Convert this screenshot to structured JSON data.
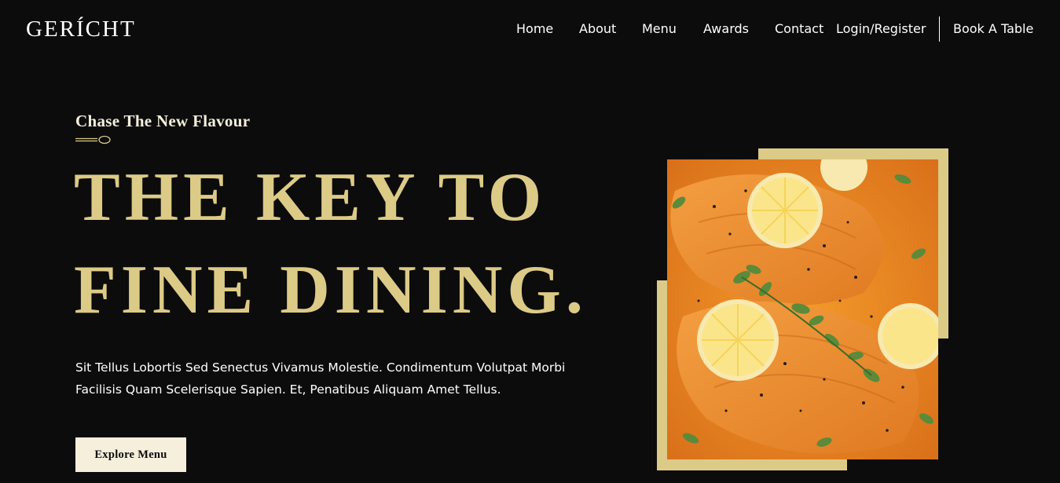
{
  "navbar": {
    "logo": "GERÍCHT",
    "links": [
      "Home",
      "About",
      "Menu",
      "Awards",
      "Contact"
    ],
    "login": "Login/Register",
    "book": "Book A Table"
  },
  "hero": {
    "subtitle": "Chase The New Flavour",
    "headline": [
      "THE KEY TO",
      "FINE DINING."
    ],
    "body": "Sit Tellus Lobortis Sed Senectus Vivamus Molestie. Condimentum Volutpat Morbi Facilisis Quam Scelerisque Sapien. Et, Penatibus Aliquam Amet Tellus.",
    "cta": "Explore Menu"
  },
  "colors": {
    "background": "#0c0c0c",
    "golden": "#dcca87",
    "cream": "#f5efdb",
    "salmon": "#e8871e"
  },
  "icons": [
    "spoon-icon"
  ]
}
